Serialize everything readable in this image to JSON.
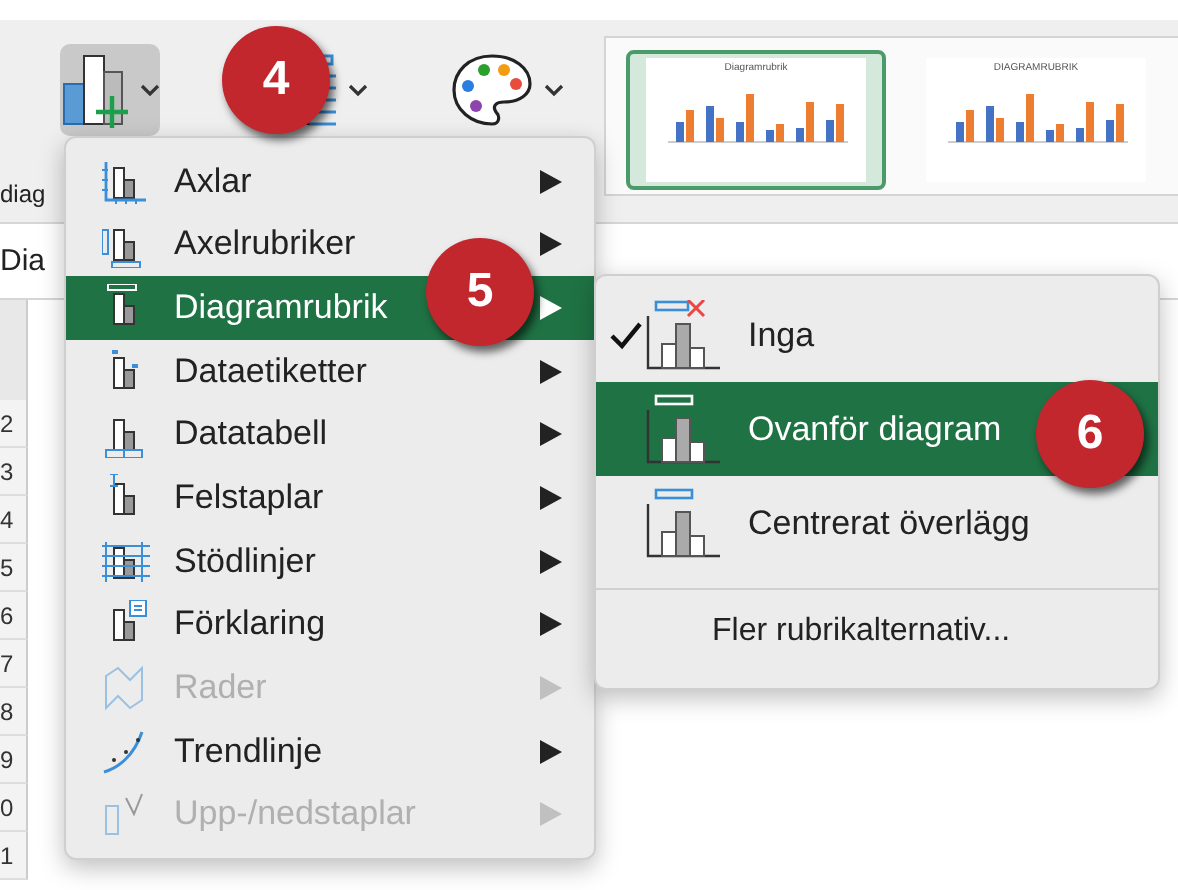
{
  "ribbon": {
    "chart_button": {
      "pressed": true
    },
    "group_label": "diag",
    "styles": [
      {
        "title": "Diagramrubrik",
        "selected": true
      },
      {
        "title": "DIAGRAMRUBRIK",
        "selected": false
      }
    ]
  },
  "sheet": {
    "name_label": "Dia",
    "row_numbers": [
      "2",
      "3",
      "4",
      "5",
      "6",
      "7",
      "8",
      "9",
      "0",
      "1"
    ]
  },
  "menu": {
    "items": [
      {
        "label": "Axlar",
        "kind": "axes",
        "disabled": false,
        "selected": false
      },
      {
        "label": "Axelrubriker",
        "kind": "axis-titles",
        "disabled": false,
        "selected": false
      },
      {
        "label": "Diagramrubrik",
        "kind": "chart-title",
        "disabled": false,
        "selected": true
      },
      {
        "label": "Dataetiketter",
        "kind": "data-labels",
        "disabled": false,
        "selected": false
      },
      {
        "label": "Datatabell",
        "kind": "data-table",
        "disabled": false,
        "selected": false
      },
      {
        "label": "Felstaplar",
        "kind": "error-bars",
        "disabled": false,
        "selected": false
      },
      {
        "label": "Stödlinjer",
        "kind": "gridlines",
        "disabled": false,
        "selected": false
      },
      {
        "label": "Förklaring",
        "kind": "legend",
        "disabled": false,
        "selected": false
      },
      {
        "label": "Rader",
        "kind": "lines",
        "disabled": true,
        "selected": false
      },
      {
        "label": "Trendlinje",
        "kind": "trendline",
        "disabled": false,
        "selected": false
      },
      {
        "label": "Upp-/nedstaplar",
        "kind": "up-down-bars",
        "disabled": true,
        "selected": false
      }
    ]
  },
  "submenu": {
    "items": [
      {
        "kind": "option",
        "label": "Inga",
        "checked": true,
        "selected": false
      },
      {
        "kind": "option",
        "label": "Ovanför diagram",
        "checked": false,
        "selected": true
      },
      {
        "kind": "option",
        "label": "Centrerat överlägg",
        "checked": false,
        "selected": false
      },
      {
        "kind": "more",
        "label": "Fler rubrikalternativ..."
      }
    ]
  },
  "badges": [
    "4",
    "5",
    "6"
  ]
}
